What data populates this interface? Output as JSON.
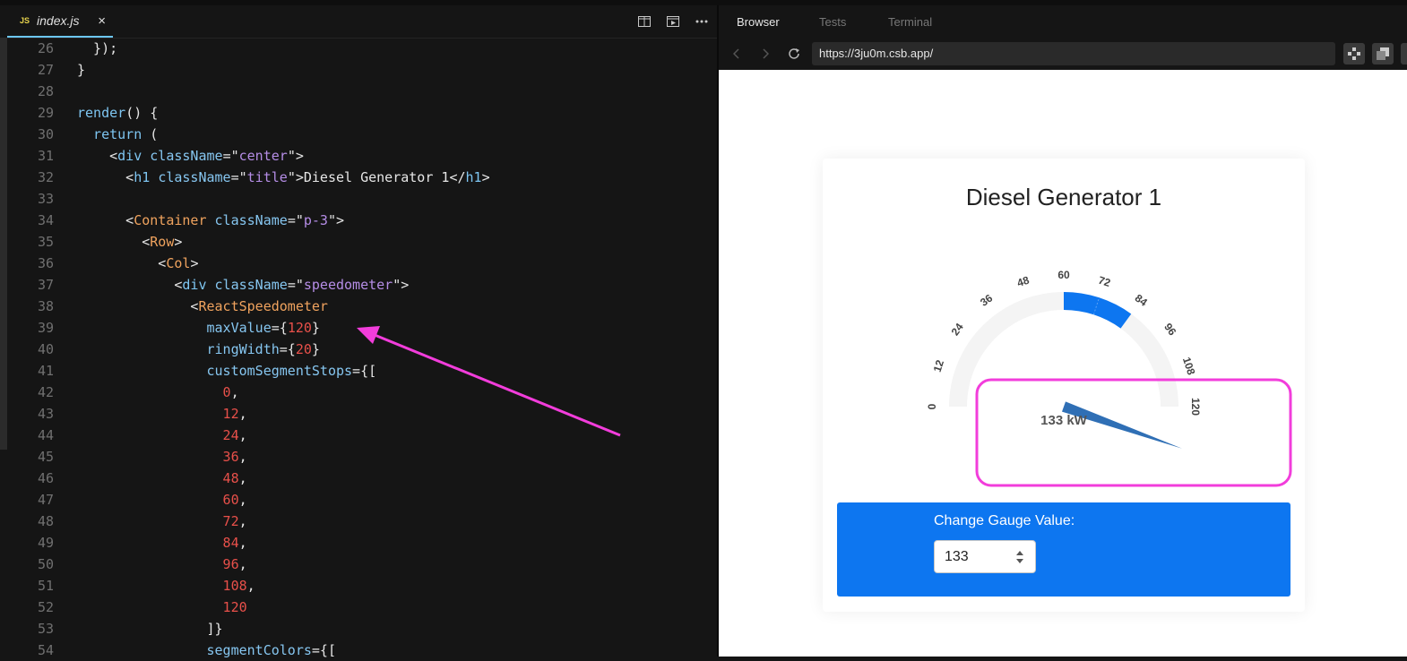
{
  "editor": {
    "tab": {
      "lang_badge": "JS",
      "filename": "index.js",
      "close": "×"
    },
    "lines": [
      {
        "n": "26",
        "tokens": [
          [
            "t-punc",
            "  });"
          ]
        ]
      },
      {
        "n": "27",
        "tokens": [
          [
            "t-punc",
            "}"
          ]
        ]
      },
      {
        "n": "28",
        "tokens": []
      },
      {
        "n": "29",
        "tokens": [
          [
            "t-kw",
            "render"
          ],
          [
            "t-punc",
            "() {"
          ]
        ]
      },
      {
        "n": "30",
        "tokens": [
          [
            "t-kw",
            "  return"
          ],
          [
            "t-punc",
            " ("
          ]
        ]
      },
      {
        "n": "31",
        "tokens": [
          [
            "t-punc",
            "    <"
          ],
          [
            "t-html",
            "div"
          ],
          [
            "t-plain",
            " "
          ],
          [
            "t-attr",
            "className"
          ],
          [
            "t-punc",
            "=\""
          ],
          [
            "t-str",
            "center"
          ],
          [
            "t-punc",
            "\">"
          ]
        ]
      },
      {
        "n": "32",
        "tokens": [
          [
            "t-punc",
            "      <"
          ],
          [
            "t-html",
            "h1"
          ],
          [
            "t-plain",
            " "
          ],
          [
            "t-attr",
            "className"
          ],
          [
            "t-punc",
            "=\""
          ],
          [
            "t-str",
            "title"
          ],
          [
            "t-punc",
            "\">"
          ],
          [
            "t-plain",
            "Diesel Generator 1"
          ],
          [
            "t-punc",
            "</"
          ],
          [
            "t-html",
            "h1"
          ],
          [
            "t-punc",
            ">"
          ]
        ]
      },
      {
        "n": "33",
        "tokens": []
      },
      {
        "n": "34",
        "tokens": [
          [
            "t-punc",
            "      <"
          ],
          [
            "t-comp",
            "Container"
          ],
          [
            "t-plain",
            " "
          ],
          [
            "t-attr",
            "className"
          ],
          [
            "t-punc",
            "=\""
          ],
          [
            "t-str",
            "p-3"
          ],
          [
            "t-punc",
            "\">"
          ]
        ]
      },
      {
        "n": "35",
        "tokens": [
          [
            "t-punc",
            "        <"
          ],
          [
            "t-comp",
            "Row"
          ],
          [
            "t-punc",
            ">"
          ]
        ]
      },
      {
        "n": "36",
        "tokens": [
          [
            "t-punc",
            "          <"
          ],
          [
            "t-comp",
            "Col"
          ],
          [
            "t-punc",
            ">"
          ]
        ]
      },
      {
        "n": "37",
        "tokens": [
          [
            "t-punc",
            "            <"
          ],
          [
            "t-html",
            "div"
          ],
          [
            "t-plain",
            " "
          ],
          [
            "t-attr",
            "className"
          ],
          [
            "t-punc",
            "=\""
          ],
          [
            "t-str",
            "speedometer"
          ],
          [
            "t-punc",
            "\">"
          ]
        ]
      },
      {
        "n": "38",
        "tokens": [
          [
            "t-punc",
            "              <"
          ],
          [
            "t-comp",
            "ReactSpeedometer"
          ]
        ]
      },
      {
        "n": "39",
        "tokens": [
          [
            "t-attr",
            "                maxValue"
          ],
          [
            "t-punc",
            "={"
          ],
          [
            "t-num",
            "120"
          ],
          [
            "t-punc",
            "}"
          ]
        ]
      },
      {
        "n": "40",
        "tokens": [
          [
            "t-attr",
            "                ringWidth"
          ],
          [
            "t-punc",
            "={"
          ],
          [
            "t-num",
            "20"
          ],
          [
            "t-punc",
            "}"
          ]
        ]
      },
      {
        "n": "41",
        "tokens": [
          [
            "t-attr",
            "                customSegmentStops"
          ],
          [
            "t-punc",
            "={["
          ]
        ]
      },
      {
        "n": "42",
        "tokens": [
          [
            "t-num",
            "                  0"
          ],
          [
            "t-punc",
            ","
          ]
        ]
      },
      {
        "n": "43",
        "tokens": [
          [
            "t-num",
            "                  12"
          ],
          [
            "t-punc",
            ","
          ]
        ]
      },
      {
        "n": "44",
        "tokens": [
          [
            "t-num",
            "                  24"
          ],
          [
            "t-punc",
            ","
          ]
        ]
      },
      {
        "n": "45",
        "tokens": [
          [
            "t-num",
            "                  36"
          ],
          [
            "t-punc",
            ","
          ]
        ]
      },
      {
        "n": "46",
        "tokens": [
          [
            "t-num",
            "                  48"
          ],
          [
            "t-punc",
            ","
          ]
        ]
      },
      {
        "n": "47",
        "tokens": [
          [
            "t-num",
            "                  60"
          ],
          [
            "t-punc",
            ","
          ]
        ]
      },
      {
        "n": "48",
        "tokens": [
          [
            "t-num",
            "                  72"
          ],
          [
            "t-punc",
            ","
          ]
        ]
      },
      {
        "n": "49",
        "tokens": [
          [
            "t-num",
            "                  84"
          ],
          [
            "t-punc",
            ","
          ]
        ]
      },
      {
        "n": "50",
        "tokens": [
          [
            "t-num",
            "                  96"
          ],
          [
            "t-punc",
            ","
          ]
        ]
      },
      {
        "n": "51",
        "tokens": [
          [
            "t-num",
            "                  108"
          ],
          [
            "t-punc",
            ","
          ]
        ]
      },
      {
        "n": "52",
        "tokens": [
          [
            "t-num",
            "                  120"
          ]
        ]
      },
      {
        "n": "53",
        "tokens": [
          [
            "t-punc",
            "                ]}"
          ]
        ]
      },
      {
        "n": "54",
        "tokens": [
          [
            "t-attr",
            "                segmentColors"
          ],
          [
            "t-punc",
            "={["
          ]
        ]
      }
    ]
  },
  "preview": {
    "tabs": [
      "Browser",
      "Tests",
      "Terminal"
    ],
    "url": "https://3ju0m.csb.app/",
    "page_title": "Diesel Generator 1",
    "gauge": {
      "min": 0,
      "max": 120,
      "ticks": [
        "0",
        "12",
        "24",
        "36",
        "48",
        "60",
        "72",
        "84",
        "96",
        "108",
        "120"
      ],
      "value": 133,
      "value_text": "133 kW",
      "highlight_from": 60,
      "highlight_to": 84,
      "colors": {
        "track": "#f4f4f4",
        "highlight": "#0d76f0",
        "needle": "#2f6fb5",
        "annotation": "#f23ddb"
      }
    },
    "control_label": "Change Gauge Value:",
    "control_value": "133"
  }
}
